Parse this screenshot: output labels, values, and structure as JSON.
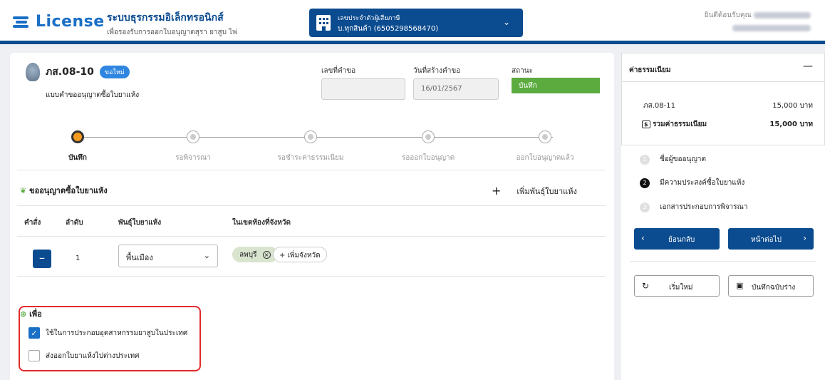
{
  "header": {
    "logo": "License",
    "title": "ระบบธุรกรรมอิเล็กทรอนิกส์",
    "subtitle": "เพื่อรองรับการออกใบอนุญาตสุรา ยาสูบ ไพ่",
    "taxpayer_label": "เลขประจำตัวผู้เสียภาษี",
    "taxpayer_value": "บ.ทุกสินค้า (6505298568470)",
    "welcome": "ยินดีต้อนรับคุณ"
  },
  "form": {
    "code": "ภส.08-10",
    "badge": "ขอใหม่",
    "name": "แบบคำขออนุญาตซื้อใบยาแห้ง",
    "request_no_label": "เลขที่คำขอ",
    "request_no_value": "",
    "created_label": "วันที่สร้างคำขอ",
    "created_value": "16/01/2567",
    "status_label": "สถานะ",
    "status_value": "บันทึก"
  },
  "steps": [
    "บันทึก",
    "รอพิจารณา",
    "รอชำระค่าธรรมเนียม",
    "รอออกใบอนุญาต",
    "ออกใบอนุญาตแล้ว"
  ],
  "section": {
    "title": "ขออนุญาตซื้อใบยาแห้ง",
    "add_variety": "เพิ่มพันธุ์ใบยาแห้ง",
    "columns": [
      "คำสั่ง",
      "ลำดับ",
      "พันธุ์ใบยาแห้ง",
      "ในเขตท้องที่จังหวัด"
    ],
    "row": {
      "index": "1",
      "variety": "พื้นเมือง",
      "province": "ลพบุรี",
      "add_province": "เพิ่มจังหวัด"
    }
  },
  "purpose": {
    "title": "เพื่อ",
    "options": [
      {
        "label": "ใช้ในการประกอบอุตสาหกรรมยาสูบในประเทศ",
        "checked": true
      },
      {
        "label": "ส่งออกใบยาแห้งไปต่างประเทศ",
        "checked": false
      }
    ]
  },
  "fees": {
    "title": "ค่าธรรมเนียม",
    "item_label": "ภส.08-11",
    "item_value": "15,000 บาท",
    "total_label": "รวมค่าธรรมเนียม",
    "total_value": "15,000 บาท"
  },
  "side_steps": [
    {
      "num": "1",
      "label": "ชื่อผู้ขออนุญาต"
    },
    {
      "num": "2",
      "label": "มีความประสงค์ซื้อใบยาแห้ง"
    },
    {
      "num": "3",
      "label": "เอกสารประกอบการพิจารณา"
    }
  ],
  "buttons": {
    "back": "ย้อนกลับ",
    "next": "หน้าต่อไป",
    "reset": "เริ่มใหม่",
    "save_draft": "บันทึกฉบับร่าง"
  }
}
